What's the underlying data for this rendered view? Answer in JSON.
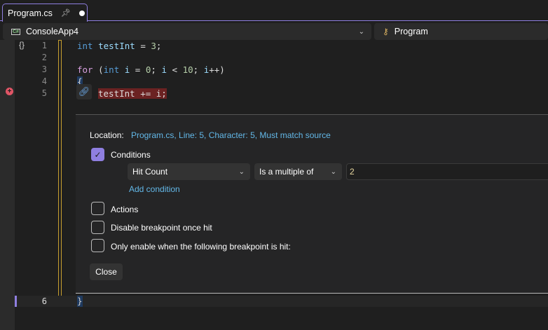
{
  "tab": {
    "title": "Program.cs",
    "pin_icon": "pin-icon",
    "modified_icon": "dot-icon"
  },
  "nav": {
    "project": "ConsoleApp4",
    "member": "Program"
  },
  "code": {
    "lines": [
      {
        "num": "1",
        "parts": [
          [
            "kw",
            "int"
          ],
          [
            "",
            " "
          ],
          [
            "var",
            "testInt"
          ],
          [
            "",
            " = "
          ],
          [
            "num",
            "3"
          ],
          [
            "",
            ";"
          ]
        ]
      },
      {
        "num": "2",
        "parts": []
      },
      {
        "num": "3",
        "parts": [
          [
            "ctl",
            "for"
          ],
          [
            "",
            " ("
          ],
          [
            "kw",
            "int"
          ],
          [
            "",
            " "
          ],
          [
            "var",
            "i"
          ],
          [
            "",
            " = "
          ],
          [
            "num",
            "0"
          ],
          [
            "",
            "; "
          ],
          [
            "var",
            "i"
          ],
          [
            "",
            " < "
          ],
          [
            "num",
            "10"
          ],
          [
            "",
            "; "
          ],
          [
            "var",
            "i"
          ],
          [
            "",
            "++)"
          ]
        ]
      },
      {
        "num": "4",
        "parts": [
          [
            "brace",
            "{"
          ]
        ]
      },
      {
        "num": "5",
        "parts": [
          [
            "hl",
            "testInt += i;"
          ]
        ]
      }
    ],
    "line6": {
      "num": "6",
      "text": "}"
    }
  },
  "breakpoint_settings": {
    "location_label": "Location:",
    "location_value": "Program.cs, Line: 5, Character: 5, Must match source",
    "conditions": {
      "label": "Conditions",
      "checked": true,
      "type": "Hit Count",
      "operator": "Is a multiple of",
      "value": "2",
      "add_condition": "Add condition"
    },
    "actions": {
      "label": "Actions",
      "checked": false
    },
    "disable_once_hit": {
      "label": "Disable breakpoint once hit",
      "checked": false
    },
    "only_enable": {
      "label": "Only enable when the following breakpoint is hit:",
      "checked": false
    },
    "close_label": "Close"
  },
  "colors": {
    "accent": "#8f7fe0",
    "breakpoint": "#e05566",
    "link": "#63b8e8"
  }
}
